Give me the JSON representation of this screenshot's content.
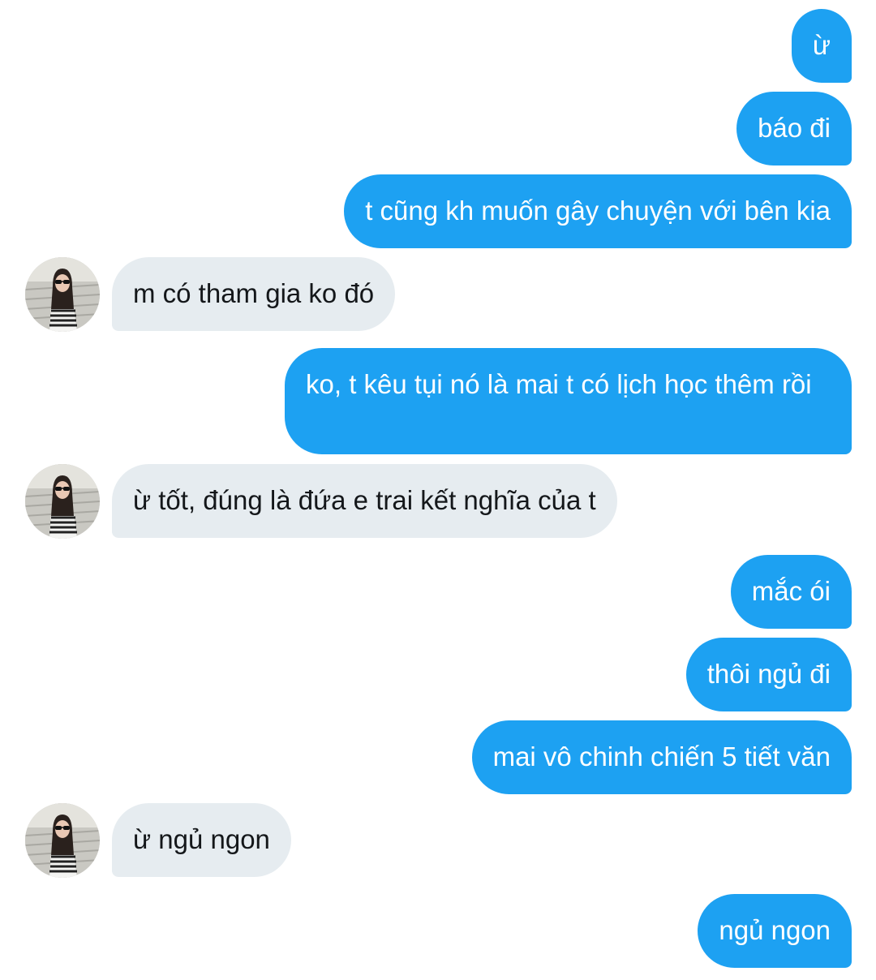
{
  "conversation": {
    "messages": [
      {
        "side": "out",
        "text": "ừ"
      },
      {
        "side": "out",
        "text": "báo đi"
      },
      {
        "side": "out",
        "text": "t cũng kh muốn gây chuyện với bên kia"
      },
      {
        "side": "in",
        "text": "m có tham gia ko đó"
      },
      {
        "side": "out",
        "text": "ko, t kêu tụi nó là mai t có lịch học thêm rồi"
      },
      {
        "side": "in",
        "text": "ừ tốt, đúng là đứa e trai kết nghĩa của t"
      },
      {
        "side": "out",
        "text": "mắc ói"
      },
      {
        "side": "out",
        "text": "thôi ngủ đi"
      },
      {
        "side": "out",
        "text": "mai vô chinh chiến 5 tiết văn"
      },
      {
        "side": "in",
        "text": "ừ ngủ ngon"
      },
      {
        "side": "out",
        "text": "ngủ ngon"
      }
    ]
  },
  "colors": {
    "outgoing_bubble": "#1da1f2",
    "incoming_bubble": "#e6ecf0",
    "outgoing_text": "#ffffff",
    "incoming_text": "#14171a"
  },
  "icons": {
    "avatar": "contact-avatar-photo"
  }
}
